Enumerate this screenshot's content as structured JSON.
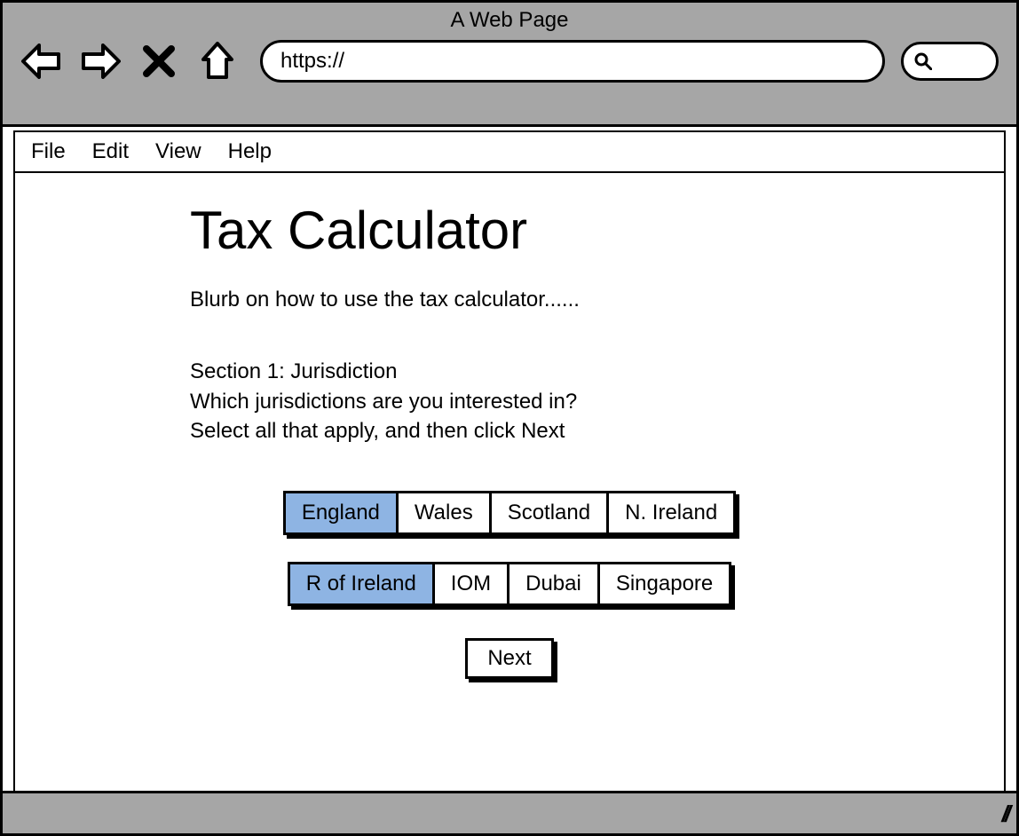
{
  "browser": {
    "title": "A Web Page",
    "url_value": "https://"
  },
  "menu": {
    "items": [
      "File",
      "Edit",
      "View",
      "Help"
    ]
  },
  "page": {
    "title": "Tax Calculator",
    "blurb": "Blurb on how to use the tax calculator......",
    "section": {
      "heading": "Section 1: Jurisdiction",
      "question": "Which jurisdictions are you interested in?",
      "instruction": "Select all that apply, and then click Next"
    },
    "jurisdiction_rows": [
      [
        {
          "label": "England",
          "selected": true
        },
        {
          "label": "Wales",
          "selected": false
        },
        {
          "label": "Scotland",
          "selected": false
        },
        {
          "label": "N. Ireland",
          "selected": false
        }
      ],
      [
        {
          "label": "R of Ireland",
          "selected": true
        },
        {
          "label": "IOM",
          "selected": false
        },
        {
          "label": "Dubai",
          "selected": false
        },
        {
          "label": "Singapore",
          "selected": false
        }
      ]
    ],
    "next_label": "Next"
  },
  "colors": {
    "selected_bg": "#8eb4e3",
    "chrome_bg": "#a6a6a6"
  }
}
